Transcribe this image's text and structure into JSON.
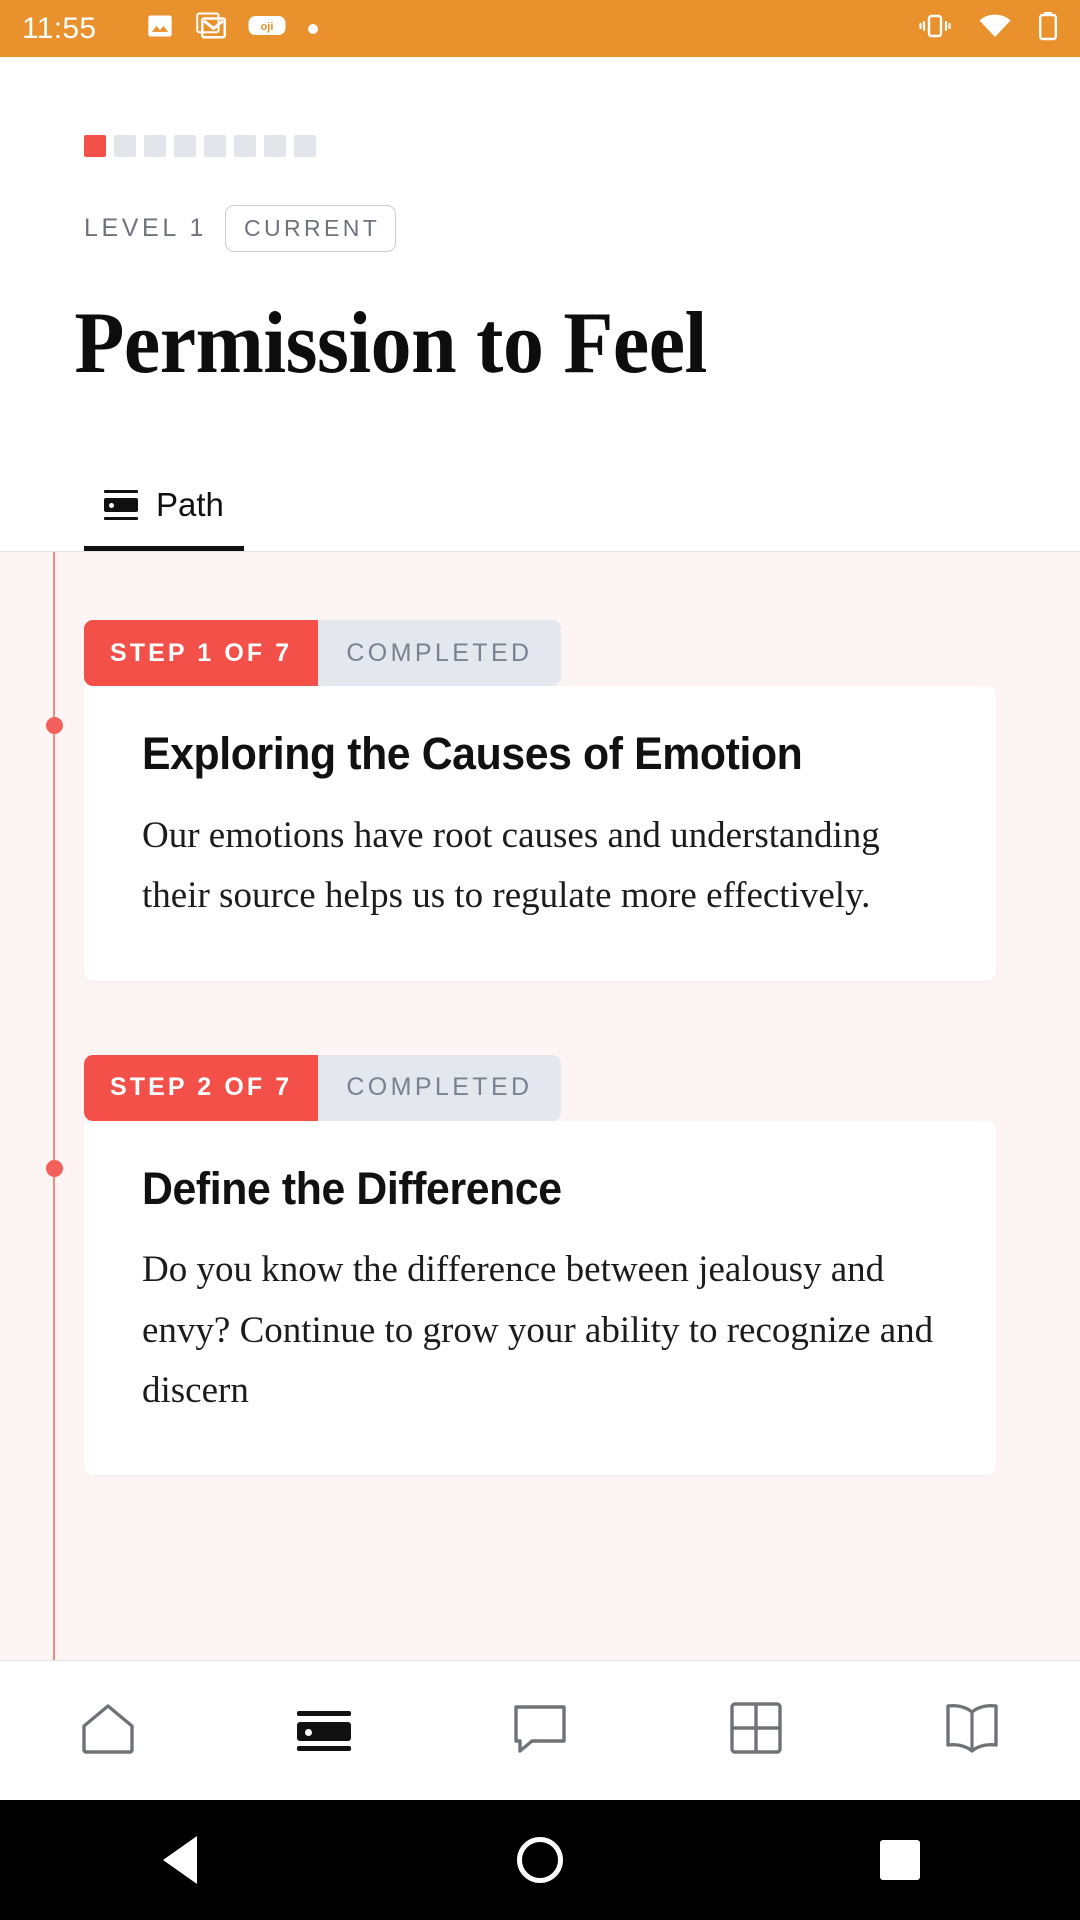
{
  "statusbar": {
    "time": "11:55",
    "left_icons": [
      "photo-icon",
      "gmail-icon",
      "oji-badge-icon",
      "dot-icon"
    ],
    "right_icons": [
      "vibrate-icon",
      "wifi-icon",
      "battery-icon"
    ],
    "background_color": "#e8912d",
    "oji_label": "oji"
  },
  "header": {
    "progress": {
      "total": 8,
      "filled": 1,
      "fill_color": "#f4504a",
      "empty_color": "#e3e5ea"
    },
    "level_label": "LEVEL 1",
    "status_badge": "CURRENT",
    "title": "Permission to Feel"
  },
  "tabs": [
    {
      "label": "Path",
      "icon": "path-icon",
      "active": true
    }
  ],
  "content": {
    "background_color": "#fdf5f3",
    "timeline_color": "#f08a86",
    "timeline_dot_color": "#f4615c",
    "cards": [
      {
        "step_label": "STEP 1 OF 7",
        "status_label": "COMPLETED",
        "title": "Exploring the Causes of Emotion",
        "body": "Our emotions have root causes and understanding their source helps us to regulate more effectively."
      },
      {
        "step_label": "STEP 2 OF 7",
        "status_label": "COMPLETED",
        "title": "Define the Difference",
        "body": "Do you know the difference between jealousy and envy?  Continue to grow your ability to recognize and discern"
      }
    ]
  },
  "bottomnav": [
    {
      "icon": "home-icon",
      "active": false
    },
    {
      "icon": "path-icon",
      "active": true
    },
    {
      "icon": "chat-bubble-icon",
      "active": false
    },
    {
      "icon": "grid-icon",
      "active": false
    },
    {
      "icon": "book-icon",
      "active": false
    }
  ],
  "androidnav": [
    {
      "icon": "back-triangle-icon"
    },
    {
      "icon": "home-circle-icon"
    },
    {
      "icon": "recents-square-icon"
    }
  ]
}
